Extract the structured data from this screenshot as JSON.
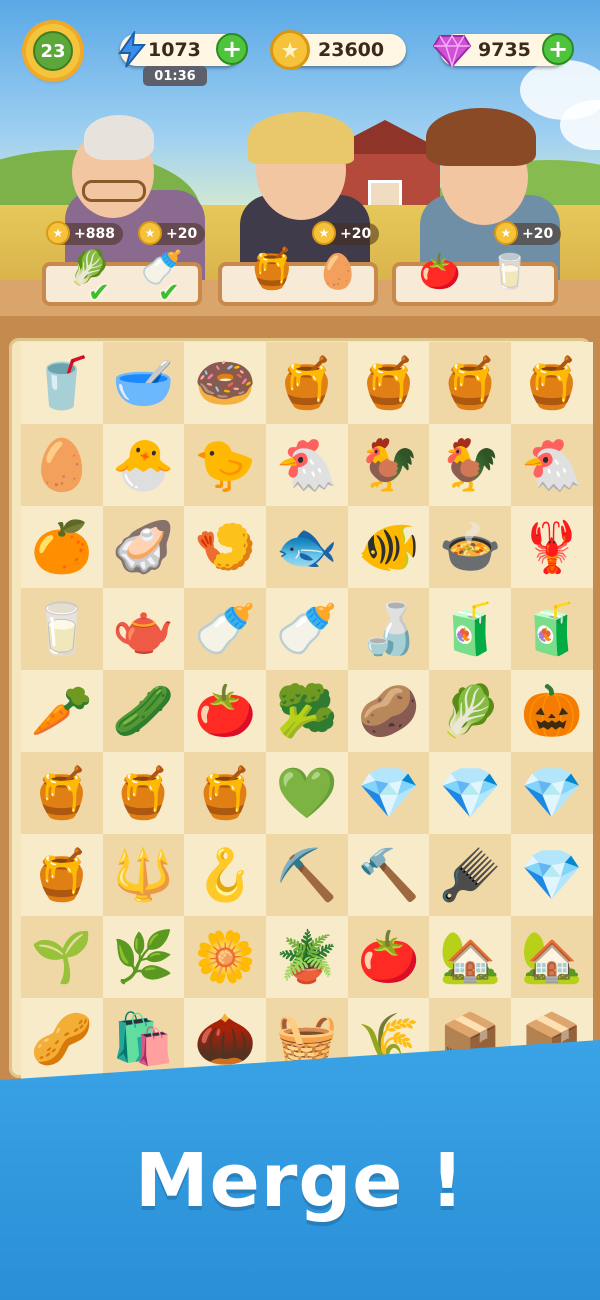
{
  "hud": {
    "level": "23",
    "energy": "1073",
    "energy_timer": "01:36",
    "coins": "23600",
    "gems": "9735",
    "plus": "+",
    "energy_icon": "lightning-icon",
    "coin_icon": "coin-icon",
    "gem_icon": "gem-icon"
  },
  "customers": [
    {
      "name": "grandma",
      "reward": "+888",
      "reward2": "+20",
      "items": [
        "cabbage",
        "milk-bottle"
      ],
      "done": [
        true,
        true
      ]
    },
    {
      "name": "farm-girl",
      "reward": "+20",
      "items": [
        "honey-jar",
        "egg"
      ],
      "done": [
        false,
        false
      ]
    },
    {
      "name": "farm-boy",
      "reward": "+20",
      "items": [
        "tomato",
        "milk-carton"
      ],
      "done": [
        false,
        false
      ]
    }
  ],
  "board": {
    "rows": [
      [
        "🥤",
        "🥣",
        "🍩",
        "🍯",
        "🍯",
        "🍯",
        "🍯"
      ],
      [
        "🥚",
        "🐣",
        "🐤",
        "🐔",
        "🐓",
        "🐓",
        "🐔"
      ],
      [
        "🍊",
        "🦪",
        "🍤",
        "🐟",
        "🐠",
        "🍲",
        "🦞"
      ],
      [
        "🥛",
        "🫖",
        "🍼",
        "🍼",
        "🍶",
        "🧃",
        "🧃"
      ],
      [
        "🥕",
        "🥒",
        "🍅",
        "🥦",
        "🥔",
        "🥬",
        "🎃"
      ],
      [
        "🍯",
        "🍯",
        "🍯",
        "💚",
        "💎",
        "💎",
        "💎"
      ],
      [
        "🍯",
        "🔱",
        "🪝",
        "⛏️",
        "🔨",
        "🪮",
        "💎"
      ],
      [
        "🌱",
        "🌿",
        "🌼",
        "🪴",
        "🍅",
        "🏡",
        "🏡"
      ],
      [
        "🥜",
        "🛍️",
        "🌰",
        "🧺",
        "🌾",
        "📦",
        "📦"
      ]
    ]
  },
  "banner": {
    "title": "Merge !"
  }
}
